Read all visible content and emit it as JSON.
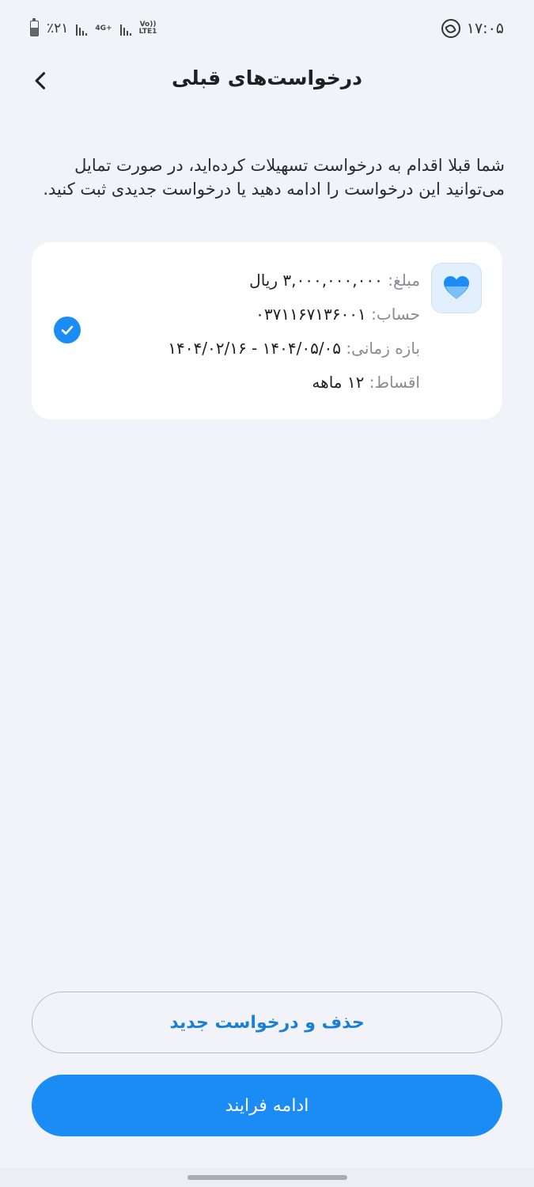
{
  "status_bar": {
    "time": "۱۷:۰۵",
    "battery": "٪۲۱",
    "network_a": "4G+",
    "network_b_top": "Vo))",
    "network_b_bottom": "LTE1"
  },
  "header": {
    "title": "درخواست‌های قبلی"
  },
  "description": "شما قبلا اقدام به درخواست تسهیلات کرده‌اید، در صورت تمایل می‌توانید این درخواست را ادامه دهید یا درخواست جدیدی ثبت کنید.",
  "request": {
    "amount_label": "مبلغ:",
    "amount_value": "۳,۰۰۰,۰۰۰,۰۰۰ ریال",
    "account_label": "حساب:",
    "account_value": "۰۳۷۱۱۶۷۱۳۶۰۰۱",
    "period_label": "بازه زمانی:",
    "period_value": "۱۴۰۴/۰۵/۰۵ - ۱۴۰۴/۰۲/۱۶",
    "installments_label": "اقساط:",
    "installments_value": "۱۲ ماهه",
    "selected": true
  },
  "actions": {
    "delete_label": "حذف و درخواست جدید",
    "continue_label": "ادامه فرایند"
  },
  "colors": {
    "accent": "#1a8cf4",
    "background": "#f2f3f8",
    "card": "#ffffff"
  },
  "icons": {
    "back": "chevron-left-icon",
    "card": "heart-icon",
    "selected": "check-circle-icon",
    "status": "whatsapp-icon"
  }
}
